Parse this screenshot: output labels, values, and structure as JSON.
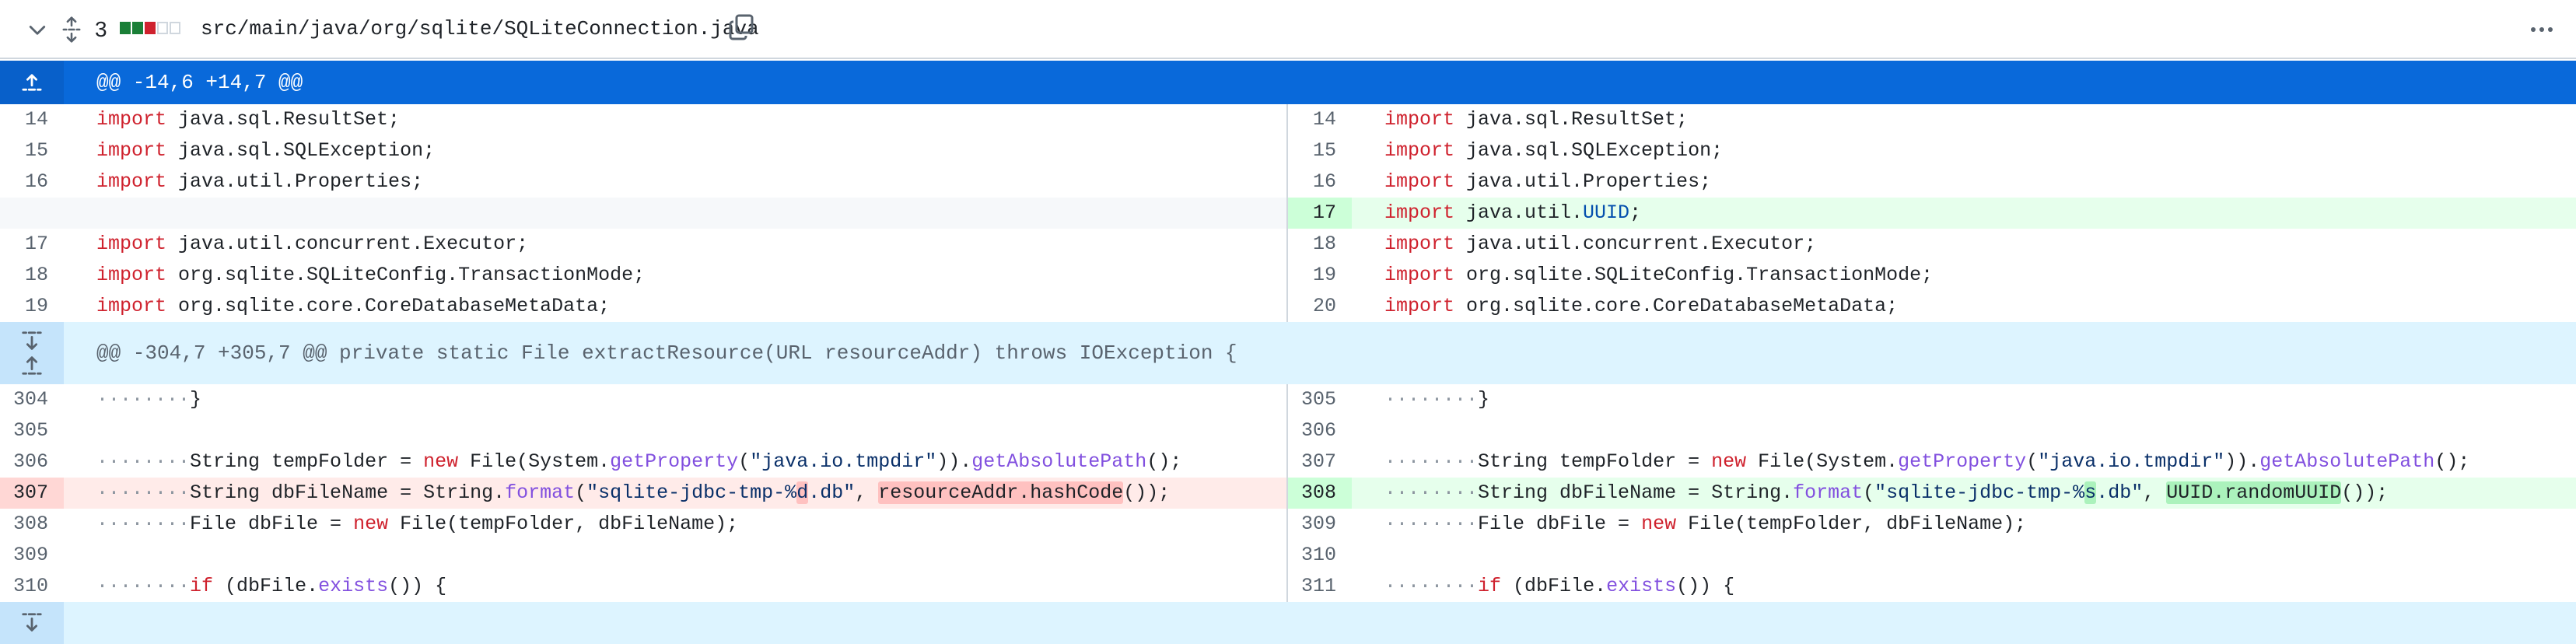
{
  "header": {
    "changes_count": "3",
    "diffstat": [
      "#1a7f37",
      "#1a7f37",
      "#cf222e",
      "#e6e9ec",
      "#e6e9ec"
    ],
    "file_path": "src/main/java/org/sqlite/SQLiteConnection.java",
    "icons": [
      "chevron-down-icon",
      "expand-all-icon",
      "copy-icon",
      "kebab-horizontal-icon"
    ]
  },
  "hunks": [
    {
      "text": "@@ -14,6 +14,7 @@",
      "background": "#0969da"
    },
    {
      "text": "@@ -304,7 +305,7 @@ private static File extractResource(URL resourceAddr) throws IOException {",
      "background": "#ddf4ff"
    },
    {
      "text": "",
      "background": "#ddf4ff"
    }
  ],
  "section1": {
    "left_nums": [
      "14",
      "15",
      "16",
      "",
      "17",
      "18",
      "19"
    ],
    "right_nums": [
      "14",
      "15",
      "16",
      "17",
      "18",
      "19",
      "20"
    ],
    "line_text": {
      "import_kw": "import",
      "resultset": " java.sql.ResultSet;",
      "sqlexception": " java.sql.SQLException;",
      "properties": " java.util.Properties;",
      "uuid_pre": " java.util.",
      "uuid_cls": "UUID",
      "uuid_post": ";",
      "executor": " java.util.concurrent.Executor;",
      "txmode": " org.sqlite.SQLiteConfig.TransactionMode;",
      "coremeta": " org.sqlite.core.CoreDatabaseMetaData;"
    }
  },
  "section2": {
    "left_nums": [
      "304",
      "305",
      "306",
      "307",
      "308",
      "309",
      "310"
    ],
    "right_nums": [
      "305",
      "306",
      "307",
      "308",
      "309",
      "310",
      "311"
    ],
    "indent": "········",
    "brace_close": "}",
    "l3": {
      "a": "String tempFolder = ",
      "new": "new",
      "b": " File(System.",
      "getprop": "getProperty",
      "c": "(",
      "str": "\"java.io.tmpdir\"",
      "d": ")).",
      "abspath": "getAbsolutePath",
      "e": "();"
    },
    "l4_left": {
      "a": "String dbFileName = String.",
      "format": "format",
      "b": "(",
      "str1": "\"sqlite-jdbc-tmp-%",
      "hl_str": "d",
      "str2": ".db\"",
      "c": ", ",
      "hl_expr": "resourceAddr.hashCode",
      "d": "());"
    },
    "l4_right": {
      "a": "String dbFileName = String.",
      "format": "format",
      "b": "(",
      "str1": "\"sqlite-jdbc-tmp-%",
      "hl_str": "s",
      "str2": ".db\"",
      "c": ", ",
      "hl_expr": "UUID.randomUUID",
      "d": "());"
    },
    "l5": {
      "a": "File dbFile = ",
      "new": "new",
      "b": " File(tempFolder, dbFileName);"
    },
    "l7": {
      "if": "if",
      "a": " (dbFile.",
      "exists": "exists",
      "b": "()) {"
    }
  },
  "colors": {
    "add_bg": "#e6ffec",
    "add_num_bg": "#ccffd8",
    "del_bg": "#ffebe9",
    "del_num_bg": "#ffd7d5",
    "keyword": "#cf222e",
    "function": "#8250df",
    "string": "#0a3069"
  }
}
